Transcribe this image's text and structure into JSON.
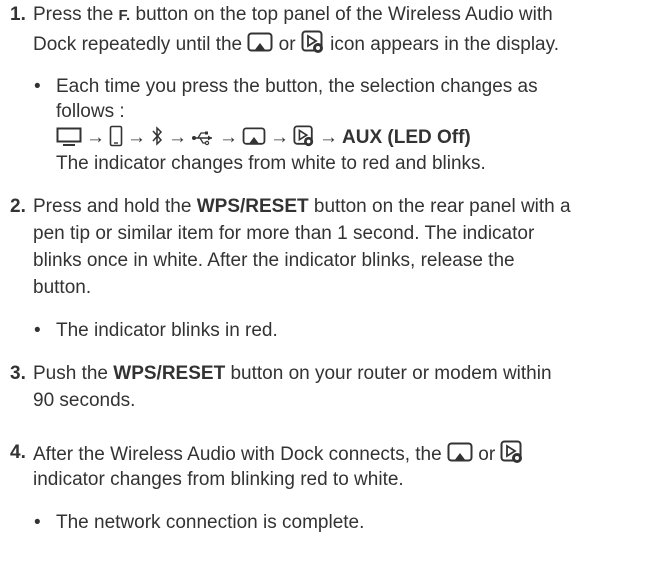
{
  "steps": [
    {
      "number": "1.",
      "text_a": "Press the ",
      "button_label": "F.",
      "text_b": " button on the top panel of the Wireless Audio with",
      "text_c": "Dock repeatedly until the ",
      "or": " or ",
      "text_d": " icon appears in the display.",
      "bullets": [
        {
          "line1": "Each time you press the button, the selection changes as",
          "line2": "follows :",
          "sequence_end": "AUX (LED Off)",
          "note": "The indicator changes from white to red and blinks."
        }
      ]
    },
    {
      "number": "2.",
      "text_a": "Press and hold the ",
      "bold": "WPS/RESET",
      "text_b": " button on the rear panel with a",
      "line2": "pen tip or similar item for more than 1 second. The indicator",
      "line3": "blinks once in white. After the indicator blinks, release the",
      "line4": "button.",
      "bullets": [
        {
          "text": "The indicator blinks in red."
        }
      ]
    },
    {
      "number": "3.",
      "text_a": "Push the ",
      "bold": "WPS/RESET",
      "text_b": " button on your router or modem within",
      "line2": "90 seconds."
    },
    {
      "number": "4.",
      "text_a": "After the Wireless Audio with Dock connects, the ",
      "or": " or ",
      "line2": "indicator changes from blinking red to white.",
      "bullets": [
        {
          "text": "The network connection is complete."
        }
      ]
    }
  ],
  "bullet_glyph": "•",
  "arrow_glyph": "→",
  "icons": [
    "airplay-icon",
    "allshare-icon",
    "tv-icon",
    "phone-icon",
    "bluetooth-icon",
    "usb-icon"
  ]
}
